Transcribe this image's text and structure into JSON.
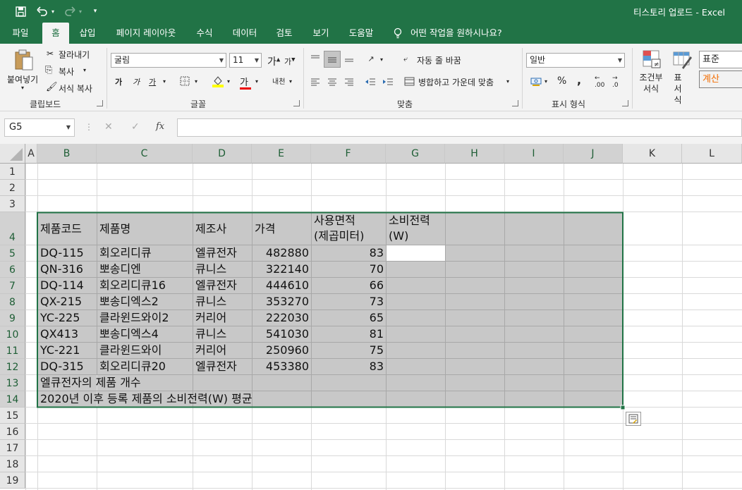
{
  "app": {
    "title": "티스토리 업로드  -  Excel"
  },
  "quick_access": [
    "save-icon",
    "undo-icon",
    "redo-icon",
    "customize-icon"
  ],
  "tabs": [
    "파일",
    "홈",
    "삽입",
    "페이지 레이아웃",
    "수식",
    "데이터",
    "검토",
    "보기",
    "도움말"
  ],
  "active_tab": "홈",
  "tell_me": "어떤 작업을 원하시나요?",
  "ribbon": {
    "clipboard": {
      "label": "클립보드",
      "paste": "붙여넣기",
      "cut": "잘라내기",
      "copy": "복사",
      "format_painter": "서식 복사"
    },
    "font": {
      "label": "글꼴",
      "name": "굴림",
      "size": "11",
      "grow": "가",
      "shrink": "가",
      "bold": "가",
      "italic": "가",
      "underline": "가",
      "font_color_glyph": "가",
      "phonetic": "내천"
    },
    "alignment": {
      "label": "맞춤",
      "wrap": "자동 줄 바꿈",
      "merge": "병합하고 가운데 맞춤"
    },
    "number": {
      "label": "표시 형식",
      "format": "일반",
      "percent": "%",
      "comma": ",",
      "inc_decimal": ".00",
      "dec_decimal": ".0"
    },
    "styles": {
      "conditional": "조건부 서식",
      "table": "표 서식",
      "normal": "표준",
      "calc": "계산"
    }
  },
  "formula_bar": {
    "name_box": "G5",
    "cancel": "✕",
    "enter": "✓",
    "fx": "fx",
    "content": ""
  },
  "columns": [
    "A",
    "B",
    "C",
    "D",
    "E",
    "F",
    "G",
    "H",
    "I",
    "J",
    "K",
    "L"
  ],
  "rows": [
    "1",
    "2",
    "3",
    "4",
    "5",
    "6",
    "7",
    "8",
    "9",
    "10",
    "11",
    "12",
    "13",
    "14",
    "15",
    "16",
    "17",
    "18",
    "19"
  ],
  "sheet": {
    "headers": [
      "제품코드",
      "제품명",
      "제조사",
      "가격",
      "사용면적\n(제곱미터)",
      "소비전력\n(W)"
    ],
    "data": [
      [
        "DQ-115",
        "회오리디큐",
        "엘큐전자",
        "482880",
        "83"
      ],
      [
        "QN-316",
        "뽀송디엔",
        "큐니스",
        "322140",
        "70"
      ],
      [
        "DQ-114",
        "회오리디큐16",
        "엘큐전자",
        "444610",
        "66"
      ],
      [
        "QX-215",
        "뽀송디엑스2",
        "큐니스",
        "353270",
        "73"
      ],
      [
        "YC-225",
        "클라윈드와이2",
        "커리어",
        "222030",
        "65"
      ],
      [
        "QX413",
        "뽀송디엑스4",
        "큐니스",
        "541030",
        "81"
      ],
      [
        "YC-221",
        "클라윈드와이",
        "커리어",
        "250960",
        "75"
      ],
      [
        "DQ-315",
        "회오리디큐20",
        "엘큐전자",
        "453380",
        "83"
      ]
    ],
    "row13": "엘큐전자의 제품 개수",
    "row14": "2020년 이후 등록 제품의 소비전력(W) 평균"
  },
  "colors": {
    "excel_green": "#217346",
    "selection_fill": "#c8c8c8",
    "selection_border": "#217346"
  }
}
